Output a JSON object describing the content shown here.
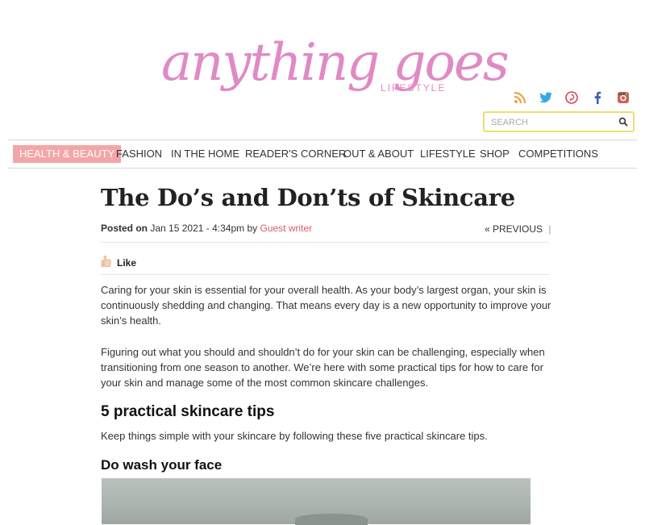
{
  "header": {
    "logo_main": "anything goes",
    "logo_sub": "LIFESTYLE",
    "brand_color": "#e08ac3",
    "social_icons": [
      "rss-icon",
      "twitter-icon",
      "pinterest-icon",
      "facebook-icon",
      "instagram-icon"
    ],
    "search": {
      "placeholder": "SEARCH"
    }
  },
  "nav": {
    "active_color": "#f4a5a8",
    "items": [
      {
        "label": "HEALTH & BEAUTY"
      },
      {
        "label": "FASHION"
      },
      {
        "label": "IN THE HOME"
      },
      {
        "label": "READER'S CORNER"
      },
      {
        "label": "OUT & ABOUT"
      },
      {
        "label": "LIFESTYLE"
      },
      {
        "label": "SHOP"
      },
      {
        "label": "COMPETITIONS"
      }
    ]
  },
  "article": {
    "title": "The Do’s and Don’ts of Skincare",
    "posted_on_label": "Posted on",
    "date": "Jan 15 2021 - 4:34pm",
    "by_label": "by",
    "author": "Guest writer",
    "previous_label": "« PREVIOUS",
    "like_label": "Like",
    "paragraphs": [
      "Caring for your skin is essential for your overall health. As your body’s largest organ, your skin is continuously shedding and changing. That means every day is a new opportunity to improve your skin’s health.",
      "Figuring out what you should and shouldn’t do for your skin can be challenging, especially when transitioning from one season to another. We’re here with some practical tips for how to care for your skin and manage some of the most common skincare challenges."
    ],
    "section_heading": "5 practical skincare tips",
    "section_intro": "Keep things simple with your skincare by following these five practical skincare tips.",
    "subheading": "Do wash your face"
  }
}
